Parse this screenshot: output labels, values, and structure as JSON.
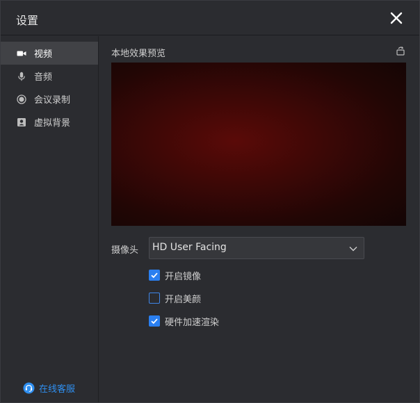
{
  "window": {
    "title": "设置"
  },
  "sidebar": {
    "items": [
      {
        "label": "视频",
        "icon": "video-camera-icon",
        "active": true
      },
      {
        "label": "音频",
        "icon": "microphone-icon",
        "active": false
      },
      {
        "label": "会议录制",
        "icon": "record-icon",
        "active": false
      },
      {
        "label": "虚拟背景",
        "icon": "portrait-icon",
        "active": false
      }
    ],
    "support": {
      "label": "在线客服",
      "icon": "headset-icon",
      "color": "#2f8ff0"
    }
  },
  "video": {
    "preview_title": "本地效果预览",
    "rotate_icon": "rotate-icon",
    "camera_label": "摄像头",
    "camera_value": "HD User Facing",
    "options": [
      {
        "label": "开启镜像",
        "checked": true
      },
      {
        "label": "开启美颜",
        "checked": false
      },
      {
        "label": "硬件加速渲染",
        "checked": true
      }
    ]
  },
  "colors": {
    "accent": "#2a7ff0",
    "background": "#2b2c30",
    "active_item": "#414246"
  }
}
